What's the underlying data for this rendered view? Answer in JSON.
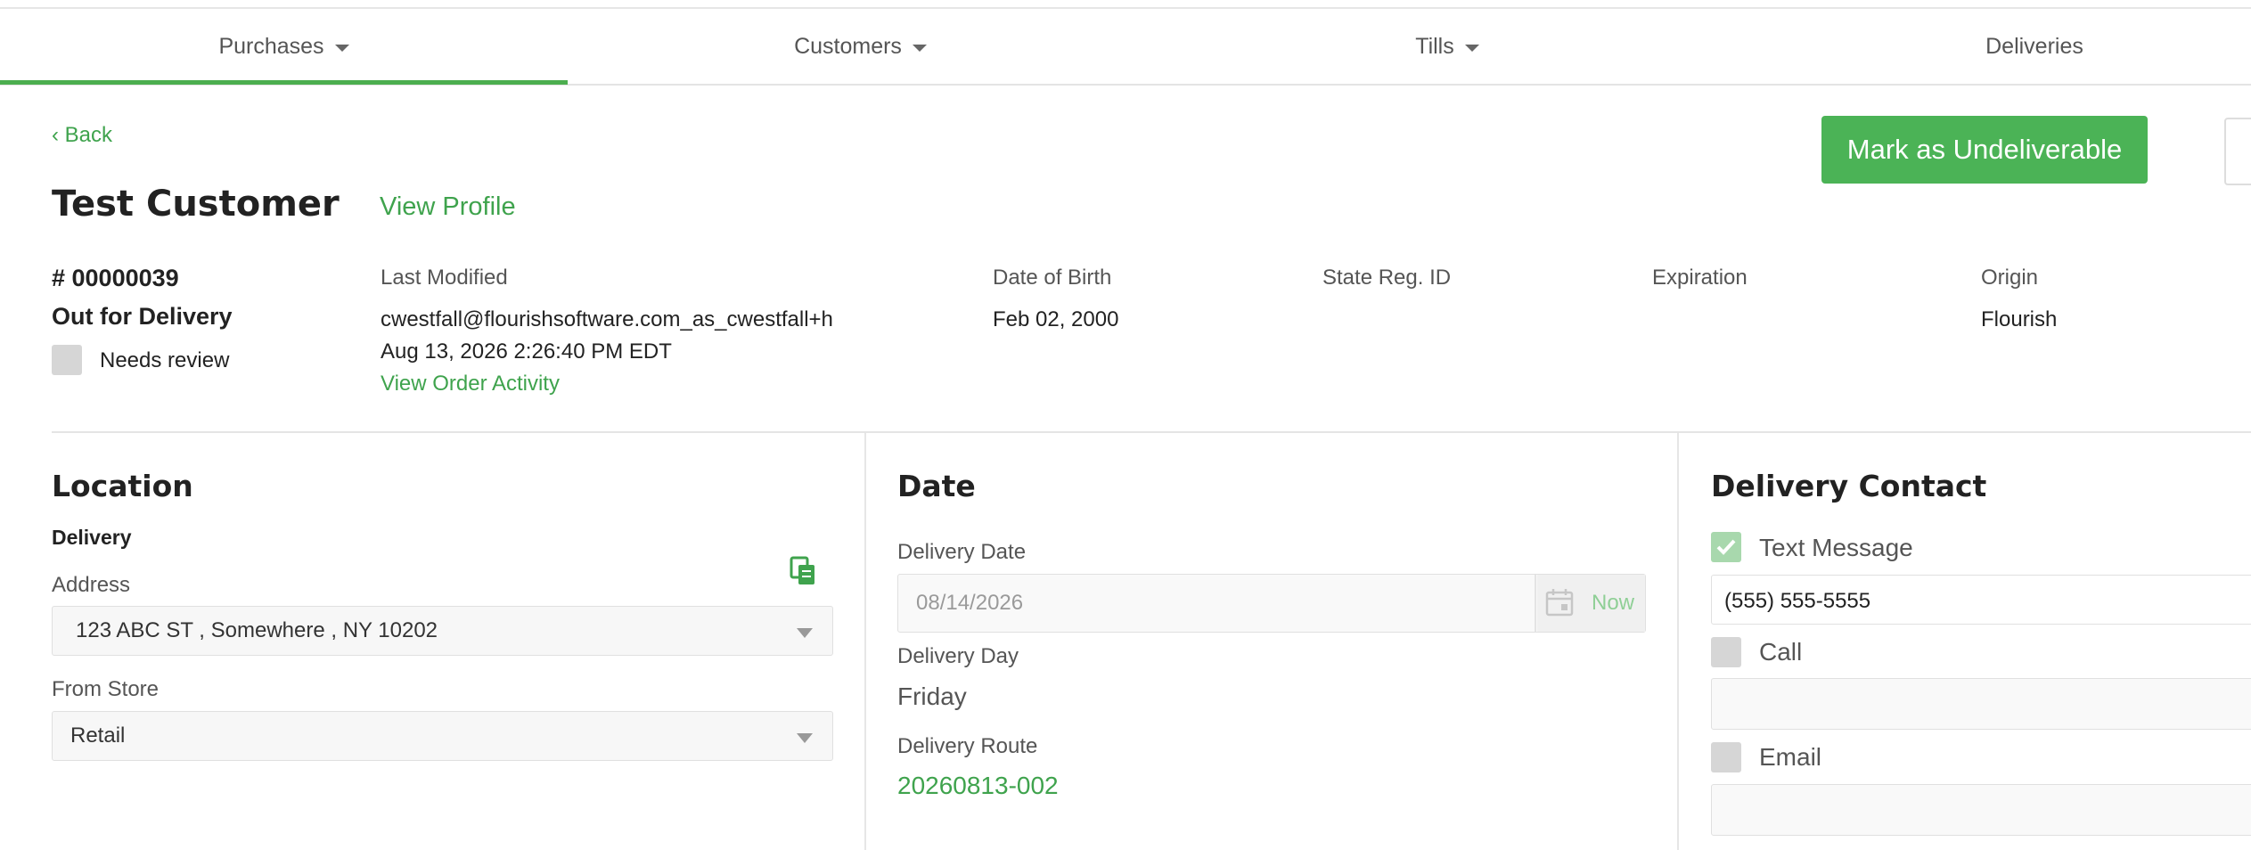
{
  "nav": {
    "items": [
      {
        "label": "Purchases",
        "has_caret": true
      },
      {
        "label": "Customers",
        "has_caret": true
      },
      {
        "label": "Tills",
        "has_caret": true
      },
      {
        "label": "Deliveries",
        "has_caret": false
      }
    ],
    "active_index": 0
  },
  "back_label": "Back",
  "actions": {
    "undeliverable_label": "Mark as Undeliverable"
  },
  "customer": {
    "name": "Test Customer",
    "view_profile_label": "View Profile"
  },
  "order": {
    "number": "# 00000039",
    "status": "Out for Delivery",
    "needs_review_label": "Needs review"
  },
  "meta": {
    "last_modified_label": "Last Modified",
    "last_modified_by": "cwestfall@flourishsoftware.com_as_cwestfall+h",
    "last_modified_at": "Aug 13, 2026 2:26:40 PM EDT",
    "view_activity_label": "View Order Activity",
    "dob_label": "Date of Birth",
    "dob_value": "Feb 02, 2000",
    "state_reg_label": "State Reg. ID",
    "expiration_label": "Expiration",
    "origin_label": "Origin",
    "origin_value": "Flourish"
  },
  "location": {
    "title": "Location",
    "subtitle": "Delivery",
    "address_label": "Address",
    "address_value": "123 ABC ST , Somewhere , NY  10202",
    "from_store_label": "From Store",
    "from_store_value": "Retail"
  },
  "date": {
    "title": "Date",
    "delivery_date_label": "Delivery Date",
    "delivery_date_value": "08/14/2026",
    "now_label": "Now",
    "delivery_day_label": "Delivery Day",
    "delivery_day_value": "Friday",
    "route_label": "Delivery Route",
    "route_value": "20260813-002"
  },
  "contact": {
    "title": "Delivery Contact",
    "text_label": "Text Message",
    "text_checked": true,
    "phone_value": "(555) 555-5555",
    "call_label": "Call",
    "email_label": "Email"
  },
  "colors": {
    "accent": "#4bb356",
    "link": "#3fa34d"
  }
}
